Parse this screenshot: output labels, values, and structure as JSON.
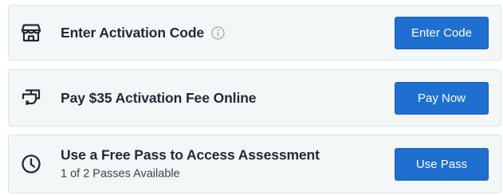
{
  "options": [
    {
      "icon": "storefront-icon",
      "title": "Enter Activation Code",
      "has_info": true,
      "button_label": "Enter Code"
    },
    {
      "icon": "receipt-icon",
      "title": "Pay $35 Activation Fee Online",
      "has_info": false,
      "button_label": "Pay Now"
    },
    {
      "icon": "clock-icon",
      "title": "Use a Free Pass to Access Assessment",
      "subtitle": "1 of 2 Passes Available",
      "button_label": "Use Pass"
    }
  ],
  "colors": {
    "button_bg": "#1e6fd0",
    "card_bg": "#f4f7f8",
    "text": "#1f2a33"
  }
}
